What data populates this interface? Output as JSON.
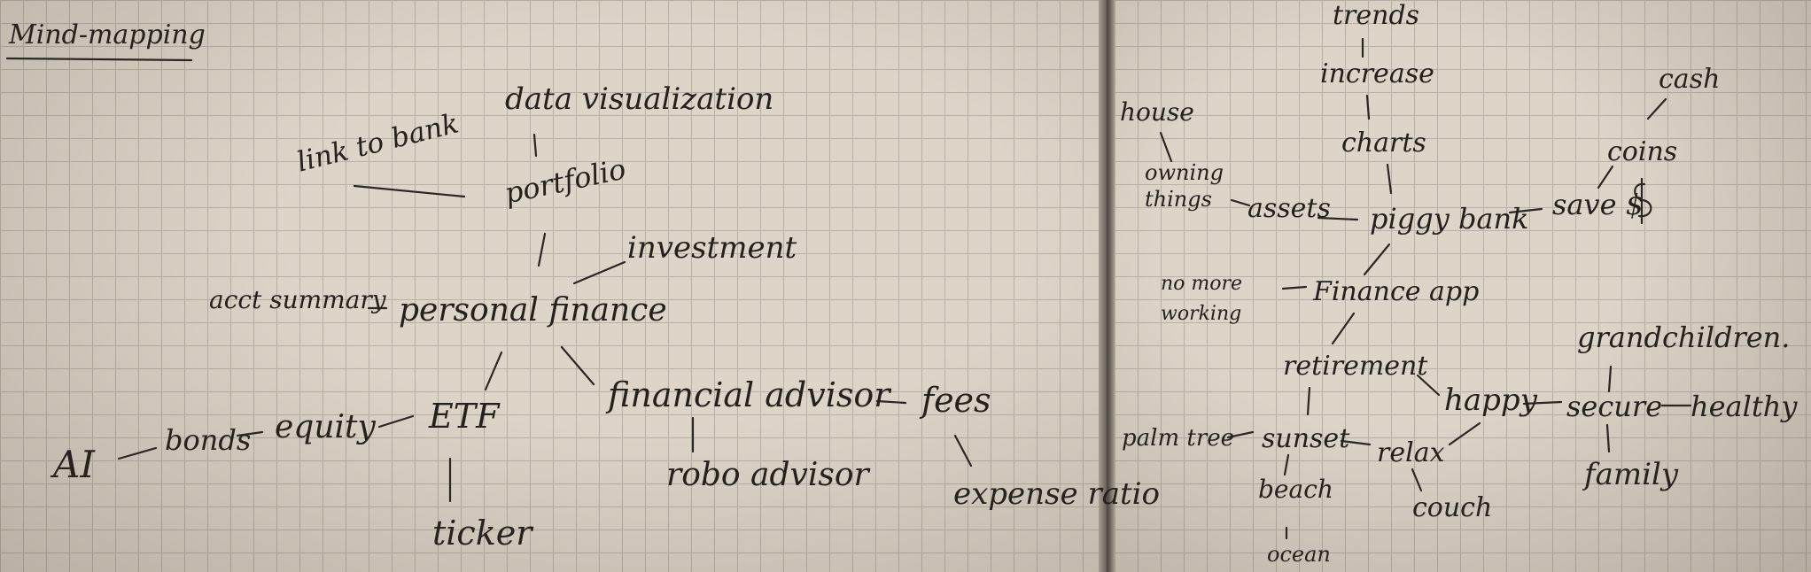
{
  "left_page": {
    "title": "Mind-mapping",
    "nodes": {
      "data_visualization": "data visualization",
      "link_to_bank": "link to bank",
      "portfolio": "portfolio",
      "investment": "investment",
      "acct_summary": "acct summary",
      "personal_finance": "personal finance",
      "financial_advisor": "financial advisor",
      "fees": "fees",
      "ai": "AI",
      "bonds": "bonds",
      "equity": "equity",
      "etf": "ETF",
      "robo_advisor": "robo advisor",
      "expense_ratio": "expense ratio",
      "ticker": "ticker"
    }
  },
  "right_page": {
    "nodes": {
      "trends": "trends",
      "increase": "increase",
      "house": "house",
      "cash": "cash",
      "charts": "charts",
      "coins": "coins",
      "owning_things": "owning things",
      "assets": "assets",
      "piggy_bank": "piggy bank",
      "save": "save $",
      "no_more_working": "no more working",
      "finance_app": "Finance app",
      "grandchildren": "grandchildren.",
      "retirement": "retirement",
      "happy": "happy",
      "secure": "secure",
      "healthy": "healthy",
      "palm_tree": "palm tree",
      "sunset": "sunset",
      "relax": "relax",
      "beach": "beach",
      "couch": "couch",
      "family": "family",
      "ocean": "ocean"
    }
  }
}
